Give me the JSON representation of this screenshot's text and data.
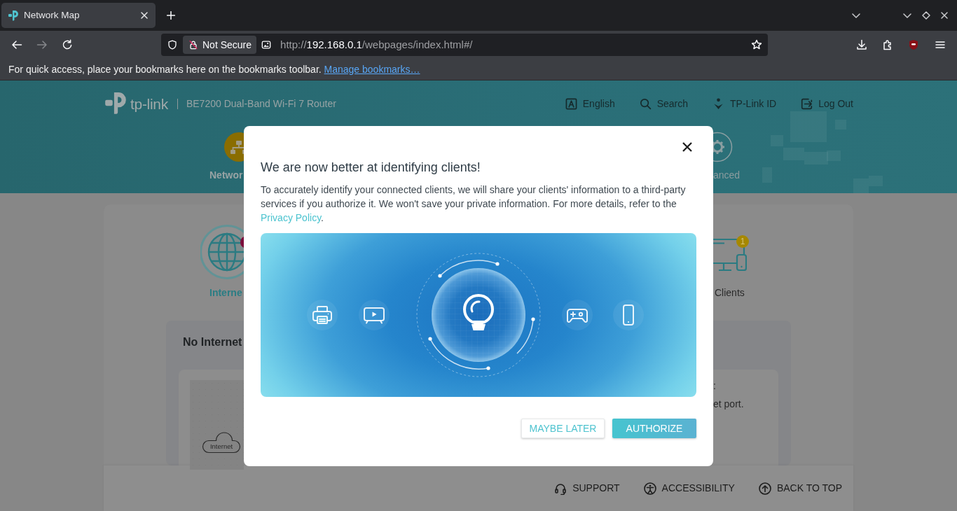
{
  "browser": {
    "tabs": [
      {
        "title": "Network Map",
        "selected": true
      }
    ],
    "toolbar_buttons": [
      {
        "kind": "back",
        "disabled": false
      },
      {
        "kind": "forward",
        "disabled": true
      },
      {
        "kind": "reload",
        "disabled": false
      }
    ],
    "security_label": "Not Secure",
    "url": {
      "scheme": "http://",
      "host": "192.168.0.1",
      "path": "/webpages/index.html#/"
    },
    "bookmarks_bar": {
      "message": "For quick access, place your bookmarks here on the bookmarks toolbar.",
      "link": "Manage bookmarks…"
    }
  },
  "header": {
    "brand": "tp-link",
    "product": "BE7200 Dual-Band Wi-Fi 7 Router",
    "links": [
      {
        "kind": "language",
        "label": "English"
      },
      {
        "kind": "search",
        "label": "Search"
      },
      {
        "kind": "account",
        "label": "TP-Link ID"
      },
      {
        "kind": "logout",
        "label": "Log Out"
      }
    ],
    "main_nav": [
      {
        "kind": "network",
        "label": "Networ",
        "selected": true
      },
      {
        "kind": "advanced",
        "label": "anced",
        "selected": false
      }
    ]
  },
  "network_map": {
    "nodes": [
      {
        "kind": "internet",
        "label": "Interne",
        "selected": true,
        "alert": true
      },
      {
        "kind": "clients",
        "label": "Clients",
        "selected": false,
        "alert": false,
        "count": "1"
      }
    ],
    "status_panel": {
      "title": "No Internet",
      "diagram_label": "Internet",
      "fragments": [
        ":",
        "et port."
      ]
    }
  },
  "footer": {
    "links": [
      {
        "kind": "support",
        "label": "SUPPORT"
      },
      {
        "kind": "accessibility",
        "label": "ACCESSIBILITY"
      },
      {
        "kind": "top",
        "label": "BACK TO TOP"
      }
    ]
  },
  "dialog": {
    "title": "We are now better at identifying clients!",
    "body": "To accurately identify your connected clients, we will share your clients' information to a third-party services if you authorize it. We won't save your private information. For more details, refer to the",
    "link": "Privacy Policy",
    "link_suffix": ".",
    "buttons": [
      {
        "kind": "outline",
        "label": "MAYBE LATER"
      },
      {
        "kind": "filled",
        "label": "AUTHORIZE"
      }
    ]
  }
}
